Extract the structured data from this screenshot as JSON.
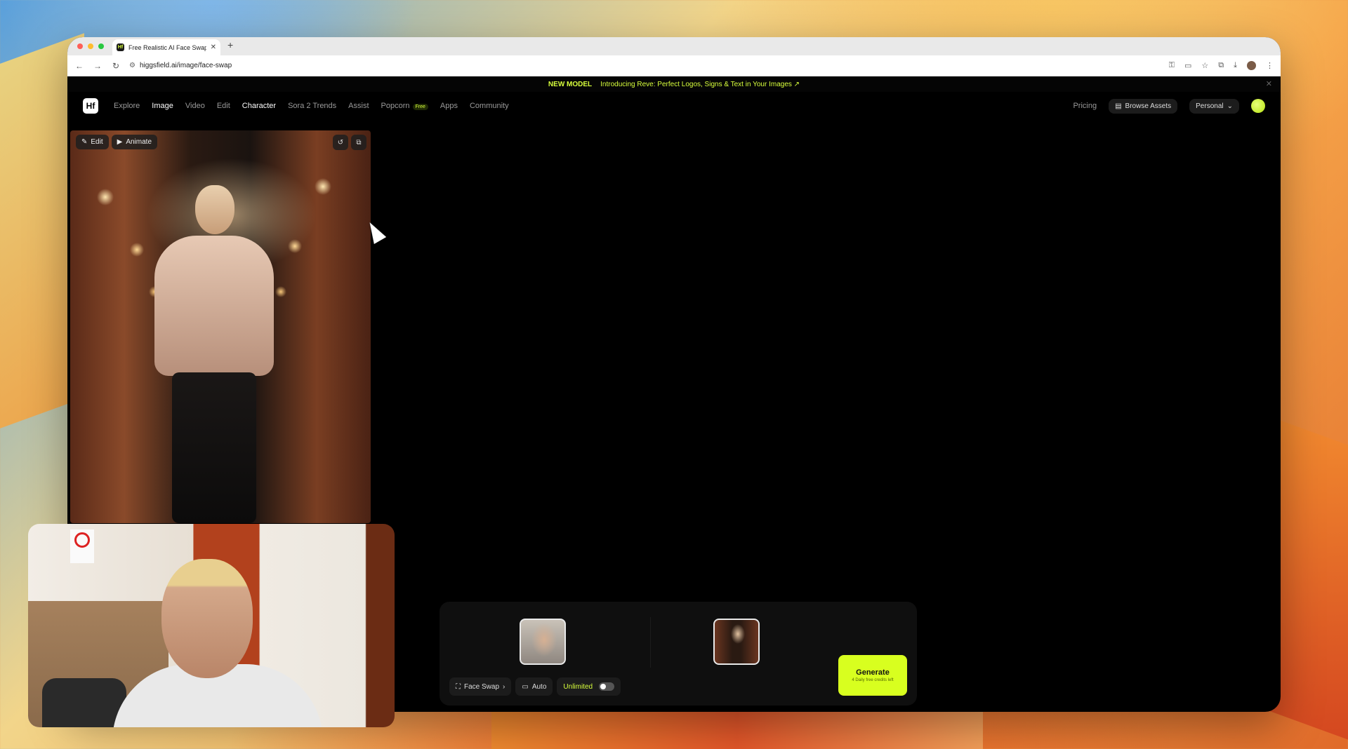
{
  "browser": {
    "tab_title": "Free Realistic AI Face Swap O",
    "tab_favicon": "Hf",
    "new_tab": "+",
    "url": "higgsfield.ai/image/face-swap"
  },
  "banner": {
    "tag": "NEW MODEL",
    "text": "Introducing Reve: Perfect Logos, Signs & Text in Your Images ↗"
  },
  "nav": {
    "logo": "Hf",
    "items": [
      {
        "label": "Explore"
      },
      {
        "label": "Image"
      },
      {
        "label": "Video"
      },
      {
        "label": "Edit"
      },
      {
        "label": "Character"
      },
      {
        "label": "Sora 2 Trends"
      },
      {
        "label": "Assist"
      },
      {
        "label": "Popcorn"
      },
      {
        "label": "Apps"
      },
      {
        "label": "Community"
      }
    ],
    "popcorn_badge": "Free",
    "pricing": "Pricing",
    "browse_assets": "Browse Assets",
    "workspace": "Personal"
  },
  "result_card": {
    "edit": "Edit",
    "animate": "Animate"
  },
  "generator": {
    "mode": "Face Swap",
    "aspect": "Auto",
    "unlimited": "Unlimited",
    "unlimited_enabled": false,
    "generate": "Generate",
    "credits": "4 Daily free credits left"
  },
  "colors": {
    "accent": "#d8ff1f",
    "background": "#000000"
  }
}
